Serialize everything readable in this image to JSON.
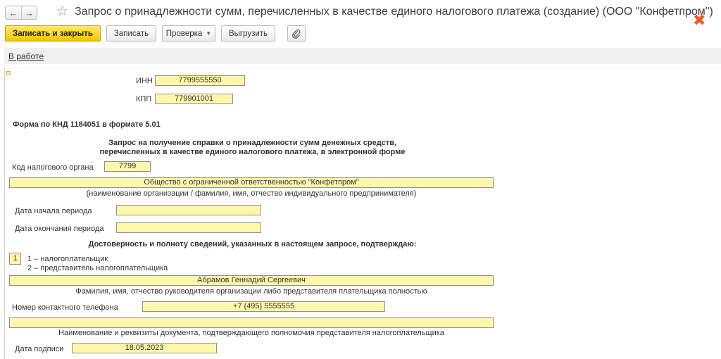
{
  "window": {
    "title": "Запрос о принадлежности сумм, перечисленных в качестве единого налогового платежа (создание) (ООО \"Конфетпром\")"
  },
  "toolbar": {
    "save_close": "Записать и закрыть",
    "save": "Записать",
    "check": "Проверка",
    "export": "Выгрузить"
  },
  "status": {
    "link": "В работе"
  },
  "form": {
    "inn_label": "ИНН",
    "inn_value": "7799555550",
    "kpp_label": "КПП",
    "kpp_value": "779901001",
    "form_code": "Форма по КНД 1184051 в формате 5.01",
    "heading_line1": "Запрос на получение справки о принадлежности сумм денежных средств,",
    "heading_line2": "перечисленных в качестве единого налогового платежа, в электронной форме",
    "tax_office_label": "Код налогового органа",
    "tax_office_value": "7799",
    "org_name": "Общество с ограниченной ответственностью \"Конфетпром\"",
    "org_name_caption": "(наименование организации / фамилия, имя, отчество индивидуального предпринимателя)",
    "period_start_label": "Дата начала периода",
    "period_start_value": "",
    "period_end_label": "Дата окончания периода",
    "period_end_value": "",
    "confirm_heading": "Достоверность и полноту сведений, указанных в настоящем запросе, подтверждаю:",
    "signer_type_value": "1",
    "signer_option1": "1 – налогоплательщик",
    "signer_option2": "2 – представитель налогоплательщика",
    "signer_name": "Абрамов Геннадий Сергеевич",
    "signer_name_caption": "Фамилия, имя, отчество руководителя организации либо представителя плательщика полностью",
    "phone_label": "Номер контактного телефона",
    "phone_value": "+7 (495) 5555555",
    "authority_doc_value": "",
    "authority_doc_caption": "Наименование и реквизиты документа, подтверждающего полномочия представителя налогоплательщика",
    "sign_date_label": "Дата подписи",
    "sign_date_value": "18.05.2023"
  },
  "colors": {
    "accent_yellow": "#f3c500",
    "field_bg": "#fff8ab",
    "close_orange": "#f05a24"
  }
}
